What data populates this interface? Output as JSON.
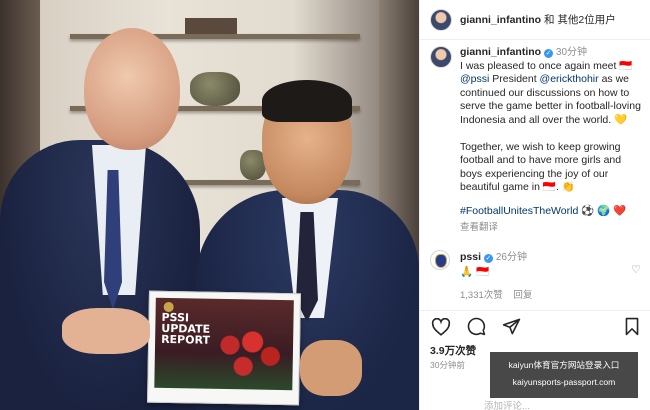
{
  "header": {
    "username": "gianni_infantino",
    "suffix": "和 其他2位用户"
  },
  "caption": {
    "username": "gianni_infantino",
    "time": "30分钟",
    "text_1": "I was pleased to once again meet 🇮🇩",
    "mention_1": "@pssi",
    "text_2": "President",
    "mention_2": "@erickthohir",
    "text_3": "as we continued our discussions on how to serve the game better in football-loving Indonesia and all over the world. 💛",
    "text_4": "Together, we wish to keep growing football and to have more girls and boys experiencing the joy of our beautiful game in 🇮🇩. 👏",
    "hashtag": "#FootballUnitesTheWorld",
    "hashtag_emoji": "⚽ 🌍 ❤️",
    "translate": "查看翻译"
  },
  "comment": {
    "username": "pssi",
    "time": "26分钟",
    "text": "🙏 🇮🇩",
    "likes": "1,331次赞",
    "reply": "回复"
  },
  "post": {
    "likes": "3.9万次赞",
    "time_ago": "30分钟前",
    "add_comment": "添加评论..."
  },
  "photo": {
    "report_title": [
      "PSSI",
      "UPDATE",
      "REPORT"
    ]
  },
  "watermark": {
    "line1": "kaiyun体育官方网站登录入口",
    "line2": "kaiyunsports-passport.com"
  },
  "icons": {
    "heart": "heart-icon",
    "comment": "comment-icon",
    "share": "share-icon",
    "save": "bookmark-icon",
    "verified": "verified-badge-icon"
  },
  "colors": {
    "link": "#00376b",
    "verified": "#3897f0",
    "muted": "#8e8e8e"
  }
}
